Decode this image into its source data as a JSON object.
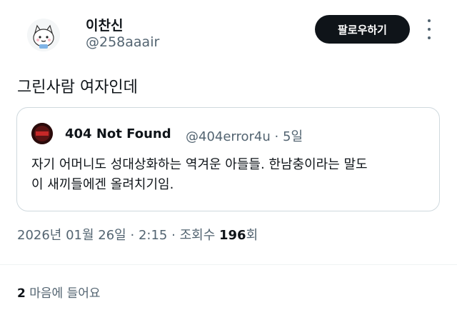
{
  "author": {
    "display_name": "이찬신",
    "handle": "@258aaair",
    "avatar_icon": "character-avatar-icon"
  },
  "actions": {
    "follow_label": "팔로우하기",
    "more_icon": "more-options-icon"
  },
  "tweet": {
    "text": "그린사람 여자인데"
  },
  "quote": {
    "name": "404 Not Found",
    "handle": "@404error4u",
    "separator": "·",
    "time": "5일",
    "avatar_icon": "404-avatar-icon",
    "body_lines": [
      "자기 어머니도 성대상화하는 역겨운 아들들. 한남충이라는 말도",
      "이 새끼들에겐 올려치기임."
    ]
  },
  "meta": {
    "date": "2026년 01월 26일",
    "separator": "·",
    "time": "2:15",
    "views_label": "조회수",
    "views_count": "196",
    "views_unit": "회"
  },
  "likes": {
    "count": "2",
    "label": "마음에 들어요"
  },
  "colors": {
    "text_primary": "#0f1419",
    "text_secondary": "#536471",
    "button_bg": "#0f1419",
    "border": "#cfd9de"
  }
}
